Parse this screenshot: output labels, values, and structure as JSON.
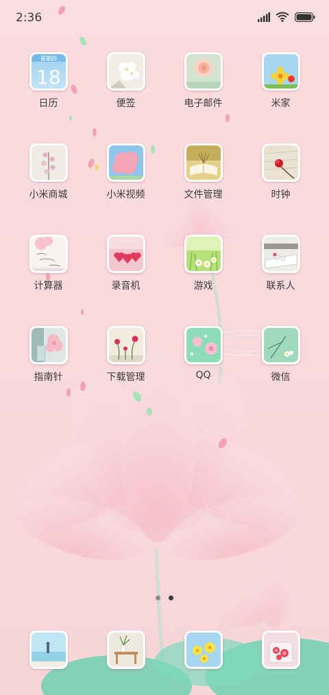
{
  "status_bar": {
    "time": "2:36",
    "icons": [
      "signal-icon",
      "wifi-icon",
      "battery-icon"
    ]
  },
  "apps": [
    {
      "label": "日历",
      "icon": "calendar-icon",
      "weekday": "星期四",
      "day": "18"
    },
    {
      "label": "便签",
      "icon": "notes-icon"
    },
    {
      "label": "电子邮件",
      "icon": "email-icon"
    },
    {
      "label": "米家",
      "icon": "mijia-icon"
    },
    {
      "label": "小米商城",
      "icon": "mi-store-icon"
    },
    {
      "label": "小米视频",
      "icon": "mi-video-icon"
    },
    {
      "label": "文件管理",
      "icon": "file-manager-icon"
    },
    {
      "label": "时钟",
      "icon": "clock-icon"
    },
    {
      "label": "计算器",
      "icon": "calculator-icon"
    },
    {
      "label": "录音机",
      "icon": "recorder-icon"
    },
    {
      "label": "游戏",
      "icon": "games-icon"
    },
    {
      "label": "联系人",
      "icon": "contacts-icon"
    },
    {
      "label": "指南针",
      "icon": "compass-icon"
    },
    {
      "label": "下载管理",
      "icon": "downloads-icon"
    },
    {
      "label": "QQ",
      "icon": "qq-icon"
    },
    {
      "label": "微信",
      "icon": "wechat-icon"
    }
  ],
  "page_indicator": {
    "pages": 2,
    "current": 2
  },
  "dock": [
    {
      "icon": "phone-icon"
    },
    {
      "icon": "messages-icon"
    },
    {
      "icon": "browser-icon"
    },
    {
      "icon": "camera-icon"
    }
  ],
  "colors": {
    "wallpaper": "#f9dcdf",
    "label_text": "#3b3b3b",
    "petal": "#f3b8c2"
  }
}
